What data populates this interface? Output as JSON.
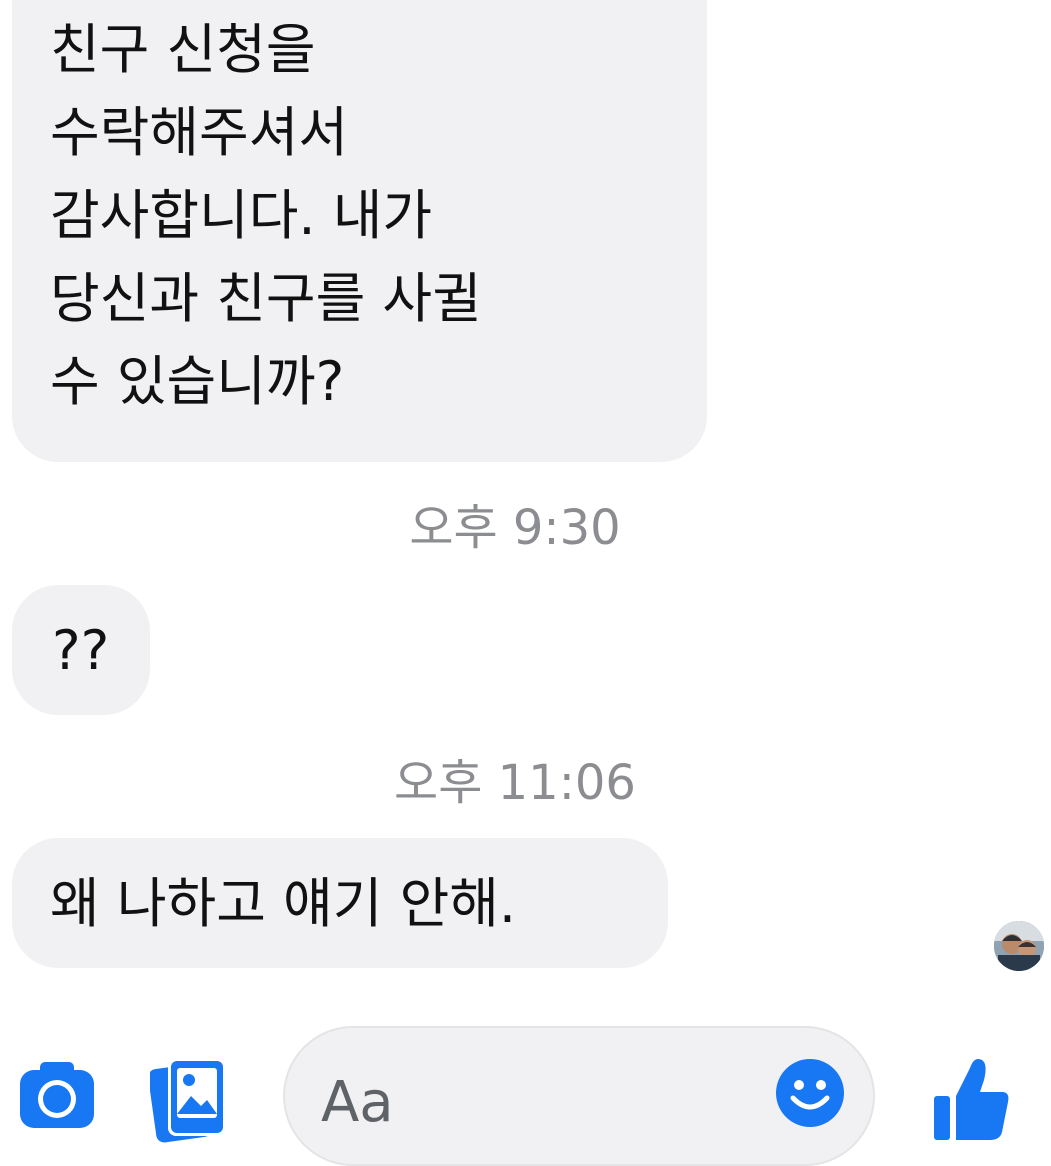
{
  "messages": [
    {
      "lines": [
        "친구 신청을",
        "수락해주셔서",
        "감사합니다.  내가",
        "당신과 친구를 사귈",
        "수 있습니까?"
      ]
    },
    {
      "timestamp": "오후 9:30"
    },
    {
      "text": "??"
    },
    {
      "timestamp": "오후 11:06"
    },
    {
      "text": "왜 나하고 얘기 안해."
    }
  ],
  "composer": {
    "placeholder": "Aa"
  },
  "icons": {
    "camera": "camera-icon",
    "gallery": "gallery-icon",
    "emoji": "emoji-icon",
    "like": "thumbs-up-icon",
    "avatar": "avatar"
  },
  "colors": {
    "accent": "#1877f2",
    "bubble": "#f1f1f3",
    "timestamp": "#8b8d90"
  }
}
